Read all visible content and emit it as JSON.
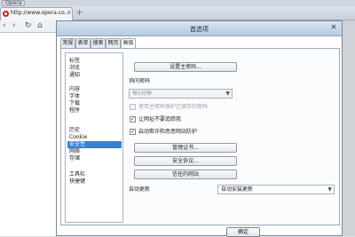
{
  "browser": {
    "menu_label": "Opera",
    "tab_title": "http://www.opera.co...",
    "tab_close": "×",
    "new_tab": "+",
    "nav": {
      "back": "‹",
      "forward": "›",
      "reload": "↻",
      "home": "⌂"
    }
  },
  "dialog": {
    "title": "首选项",
    "close": "✕",
    "tabs": [
      "常规",
      "表单",
      "搜索",
      "网页",
      "高级"
    ],
    "active_tab": "高级",
    "categories": [
      "标签",
      "浏览",
      "通知",
      "内容",
      "字体",
      "下载",
      "程序",
      "历史",
      "Cookie",
      "安全性",
      "网络",
      "存储",
      "工具栏",
      "快捷键"
    ],
    "selected_category": "安全性",
    "master_password_button": "设置主密码...",
    "ask_password_label": "询问密码",
    "ask_password_value": "每5分钟",
    "use_master_password_label": "使用主密码保护已保存的密码",
    "use_master_password_checked": false,
    "use_master_password_enabled": false,
    "inform_insecure_label": "让网址不要追踪我",
    "inform_insecure_checked": true,
    "fraud_protection_label": "启动欺诈和恶意网站防护",
    "fraud_protection_checked": true,
    "manage_certificates_button": "管理证书...",
    "security_protocols_button": "安全协议...",
    "trusted_sites_button": "信任的网站",
    "auto_update_label": "自动更新",
    "auto_update_value": "自动安装更新",
    "ok_button": "确定"
  }
}
